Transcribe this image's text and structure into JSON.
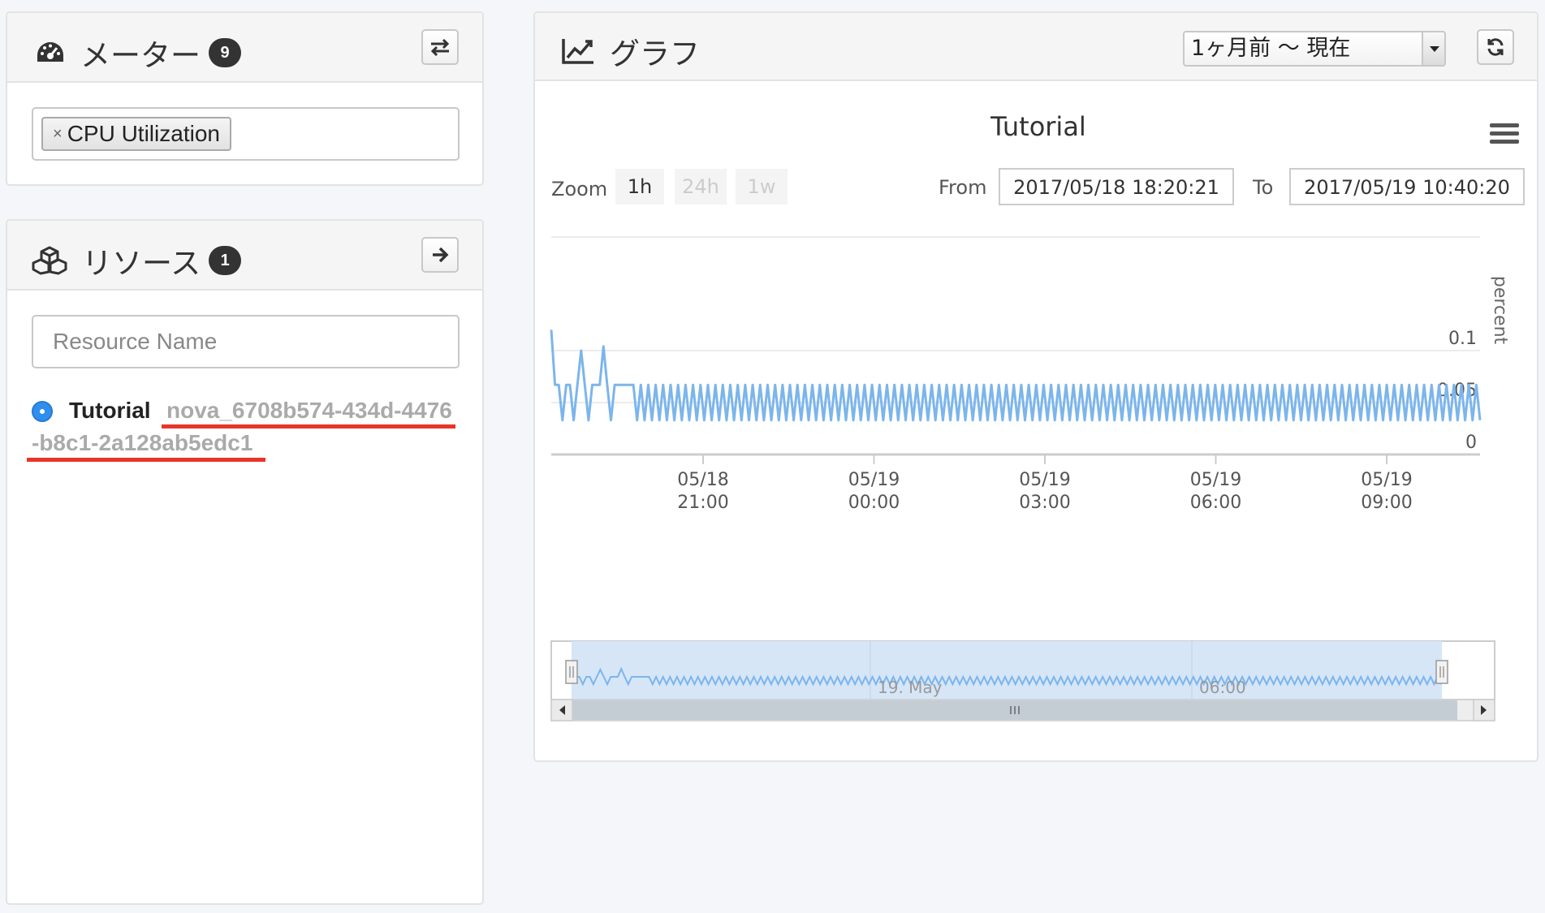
{
  "meter": {
    "title": "メーター",
    "count": "9",
    "selected_tag": "CPU Utilization",
    "tag_remove": "×"
  },
  "resource": {
    "title": "リソース",
    "count": "1",
    "search_placeholder": "Resource Name",
    "item": {
      "name": "Tutorial",
      "id_line1": "nova_6708b574-434d-4476",
      "id_line2": "-b8c1-2a128ab5edc1"
    }
  },
  "graph": {
    "title": "グラフ",
    "range_selected": "1ヶ月前 〜 現在"
  },
  "colors": {
    "series": "#7cb5ec",
    "navigator_fill": "#d6e6f7",
    "highlight_underline": "#e8352a",
    "radio": "#2f8ff0"
  },
  "icons": {
    "meter": "dashboard-icon",
    "swap": "swap-arrows-icon",
    "resource": "cubes-icon",
    "next": "arrow-right-icon",
    "graph": "line-chart-icon",
    "refresh": "refresh-icon",
    "menu": "hamburger-menu-icon"
  },
  "chart_data": {
    "type": "line",
    "title": "Tutorial",
    "zoom_label": "Zoom",
    "zoom_buttons": [
      "1h",
      "24h",
      "1w"
    ],
    "from_label": "From",
    "from_value": "2017/05/18 18:20:21",
    "to_label": "To",
    "to_value": "2017/05/19 10:40:20",
    "ylabel": "percent",
    "ylim": [
      0,
      0.1
    ],
    "y_ticks": [
      "0.1",
      "0.05",
      "0"
    ],
    "x_ticks": [
      {
        "date": "05/18",
        "time": "21:00"
      },
      {
        "date": "05/19",
        "time": "00:00"
      },
      {
        "date": "05/19",
        "time": "03:00"
      },
      {
        "date": "05/19",
        "time": "06:00"
      },
      {
        "date": "05/19",
        "time": "09:00"
      }
    ],
    "navigator_labels": [
      "19. May",
      "06:00"
    ],
    "grid": true,
    "series": [
      {
        "start_values": [
          0.134,
          0.067,
          0.067,
          0.033,
          0.067,
          0.067,
          0.033,
          0.067,
          0.1,
          0.067,
          0.033,
          0.067,
          0.067,
          0.067,
          0.104,
          0.067,
          0.033,
          0.067,
          0.067,
          0.067,
          0.067,
          0.067
        ],
        "repeat_pattern": [
          0.067,
          0.033
        ],
        "approx_points": 250
      }
    ]
  }
}
